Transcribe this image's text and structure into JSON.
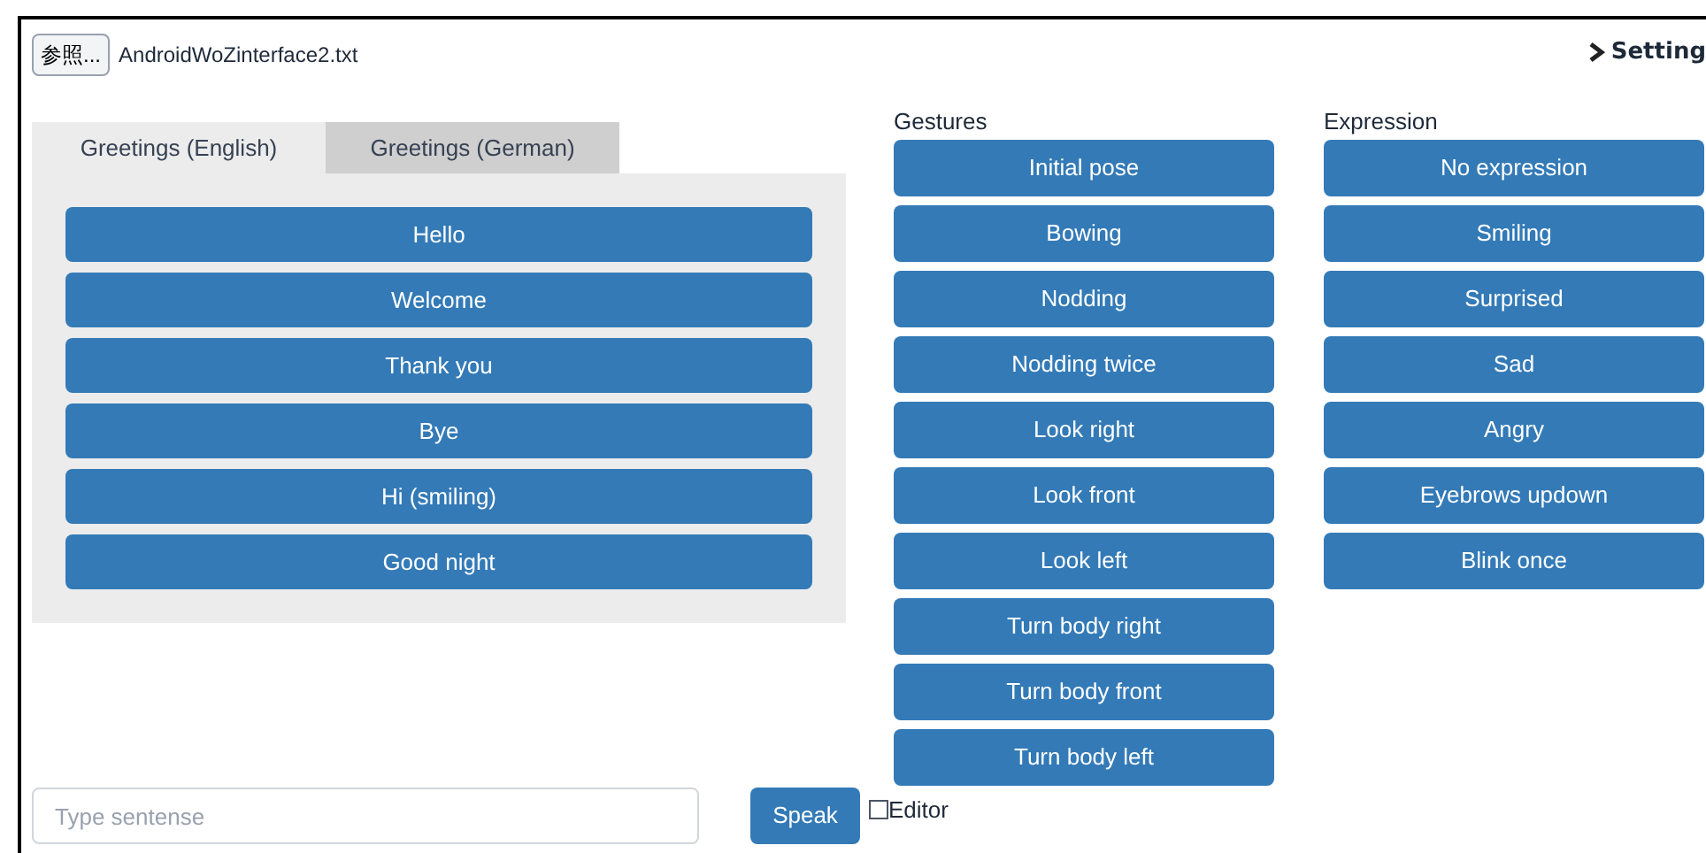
{
  "file_picker": {
    "button": "参照...",
    "file_name": "AndroidWoZinterface2.txt"
  },
  "setting_link": {
    "label": "Setting",
    "expanded": false
  },
  "tabs": [
    {
      "label": "Greetings (English)",
      "selected": true
    },
    {
      "label": "Greetings (German)",
      "selected": false
    }
  ],
  "phrases": [
    "Hello",
    "Welcome",
    "Thank you",
    "Bye",
    "Hi (smiling)",
    "Good night"
  ],
  "gestures": {
    "label": "Gestures",
    "buttons": [
      "Initial pose",
      "Bowing",
      "Nodding",
      "Nodding twice",
      "Look right",
      "Look front",
      "Look left",
      "Turn body right",
      "Turn body front",
      "Turn body left"
    ]
  },
  "expression": {
    "label": "Expression",
    "buttons": [
      "No expression",
      "Smiling",
      "Surprised",
      "Sad",
      "Angry",
      "Eyebrows updown",
      "Blink once"
    ]
  },
  "sentence_input": {
    "placeholder": "Type sentense"
  },
  "speak_button": "Speak",
  "editor_checkbox": {
    "label": "Editor",
    "checked": false
  }
}
